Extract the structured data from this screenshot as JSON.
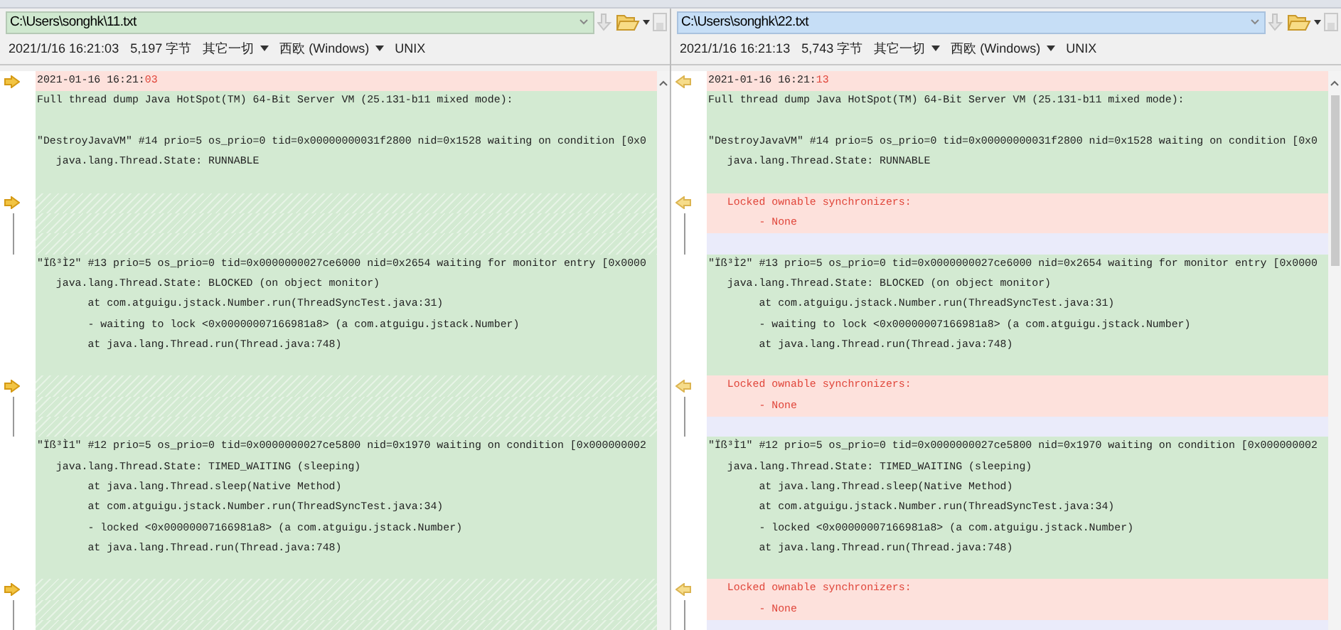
{
  "panes": [
    {
      "path": "C:\\Users\\songhk\\11.txt",
      "path_focused": false,
      "info": {
        "timestamp": "2021/1/16 16:21:03",
        "size": "5,197 字节",
        "charset": "其它一切",
        "encoding": "西欧 (Windows)",
        "line_ending": "UNIX"
      },
      "lines": [
        {
          "kind": "changed",
          "marker": true,
          "segments": [
            {
              "text": "2021-01-16 16:21:",
              "changed": false
            },
            {
              "text": "03",
              "changed": true
            }
          ]
        },
        {
          "kind": "same",
          "marker": false,
          "text": "Full thread dump Java HotSpot(TM) 64-Bit Server VM (25.131-b11 mixed mode):"
        },
        {
          "kind": "same",
          "marker": false
        },
        {
          "kind": "same",
          "marker": false,
          "text": "\"DestroyJavaVM\" #14 prio=5 os_prio=0 tid=0x00000000031f2800 nid=0x1528 waiting on condition [0x0"
        },
        {
          "kind": "same",
          "marker": false,
          "text": "   java.lang.Thread.State: RUNNABLE"
        },
        {
          "kind": "same",
          "marker": false
        },
        {
          "kind": "filler",
          "marker": true
        },
        {
          "kind": "filler",
          "marker": false
        },
        {
          "kind": "filler",
          "marker": false
        },
        {
          "kind": "same",
          "marker": false,
          "text": "\"Ïß³Ì2\" #13 prio=5 os_prio=0 tid=0x0000000027ce6000 nid=0x2654 waiting for monitor entry [0x0000"
        },
        {
          "kind": "same",
          "marker": false,
          "text": "   java.lang.Thread.State: BLOCKED (on object monitor)"
        },
        {
          "kind": "same",
          "marker": false,
          "text": "        at com.atguigu.jstack.Number.run(ThreadSyncTest.java:31)"
        },
        {
          "kind": "same",
          "marker": false,
          "text": "        - waiting to lock <0x00000007166981a8> (a com.atguigu.jstack.Number)"
        },
        {
          "kind": "same",
          "marker": false,
          "text": "        at java.lang.Thread.run(Thread.java:748)"
        },
        {
          "kind": "same",
          "marker": false
        },
        {
          "kind": "filler",
          "marker": true
        },
        {
          "kind": "filler",
          "marker": false
        },
        {
          "kind": "filler",
          "marker": false
        },
        {
          "kind": "same",
          "marker": false,
          "text": "\"Ïß³Ì1\" #12 prio=5 os_prio=0 tid=0x0000000027ce5800 nid=0x1970 waiting on condition [0x000000002"
        },
        {
          "kind": "same",
          "marker": false,
          "text": "   java.lang.Thread.State: TIMED_WAITING (sleeping)"
        },
        {
          "kind": "same",
          "marker": false,
          "text": "        at java.lang.Thread.sleep(Native Method)"
        },
        {
          "kind": "same",
          "marker": false,
          "text": "        at com.atguigu.jstack.Number.run(ThreadSyncTest.java:34)"
        },
        {
          "kind": "same",
          "marker": false,
          "text": "        - locked <0x00000007166981a8> (a com.atguigu.jstack.Number)"
        },
        {
          "kind": "same",
          "marker": false,
          "text": "        at java.lang.Thread.run(Thread.java:748)"
        },
        {
          "kind": "same",
          "marker": false
        },
        {
          "kind": "filler",
          "marker": true
        },
        {
          "kind": "filler",
          "marker": false
        },
        {
          "kind": "filler",
          "marker": false
        }
      ]
    },
    {
      "path": "C:\\Users\\songhk\\22.txt",
      "path_focused": true,
      "info": {
        "timestamp": "2021/1/16 16:21:13",
        "size": "5,743 字节",
        "charset": "其它一切",
        "encoding": "西欧 (Windows)",
        "line_ending": "UNIX"
      },
      "lines": [
        {
          "kind": "changed",
          "marker": true,
          "segments": [
            {
              "text": "2021-01-16 16:21:",
              "changed": false
            },
            {
              "text": "13",
              "changed": true
            }
          ]
        },
        {
          "kind": "same",
          "marker": false,
          "text": "Full thread dump Java HotSpot(TM) 64-Bit Server VM (25.131-b11 mixed mode):"
        },
        {
          "kind": "same",
          "marker": false
        },
        {
          "kind": "same",
          "marker": false,
          "text": "\"DestroyJavaVM\" #14 prio=5 os_prio=0 tid=0x00000000031f2800 nid=0x1528 waiting on condition [0x0"
        },
        {
          "kind": "same",
          "marker": false,
          "text": "   java.lang.Thread.State: RUNNABLE"
        },
        {
          "kind": "same",
          "marker": false
        },
        {
          "kind": "added",
          "marker": true,
          "text": "   Locked ownable synchronizers:"
        },
        {
          "kind": "added",
          "marker": false,
          "text": "        - None"
        },
        {
          "kind": "empty",
          "marker": false
        },
        {
          "kind": "same",
          "marker": false,
          "text": "\"Ïß³Ì2\" #13 prio=5 os_prio=0 tid=0x0000000027ce6000 nid=0x2654 waiting for monitor entry [0x0000"
        },
        {
          "kind": "same",
          "marker": false,
          "text": "   java.lang.Thread.State: BLOCKED (on object monitor)"
        },
        {
          "kind": "same",
          "marker": false,
          "text": "        at com.atguigu.jstack.Number.run(ThreadSyncTest.java:31)"
        },
        {
          "kind": "same",
          "marker": false,
          "text": "        - waiting to lock <0x00000007166981a8> (a com.atguigu.jstack.Number)"
        },
        {
          "kind": "same",
          "marker": false,
          "text": "        at java.lang.Thread.run(Thread.java:748)"
        },
        {
          "kind": "same",
          "marker": false
        },
        {
          "kind": "added",
          "marker": true,
          "text": "   Locked ownable synchronizers:"
        },
        {
          "kind": "added",
          "marker": false,
          "text": "        - None"
        },
        {
          "kind": "empty",
          "marker": false
        },
        {
          "kind": "same",
          "marker": false,
          "text": "\"Ïß³Ì1\" #12 prio=5 os_prio=0 tid=0x0000000027ce5800 nid=0x1970 waiting on condition [0x000000002"
        },
        {
          "kind": "same",
          "marker": false,
          "text": "   java.lang.Thread.State: TIMED_WAITING (sleeping)"
        },
        {
          "kind": "same",
          "marker": false,
          "text": "        at java.lang.Thread.sleep(Native Method)"
        },
        {
          "kind": "same",
          "marker": false,
          "text": "        at com.atguigu.jstack.Number.run(ThreadSyncTest.java:34)"
        },
        {
          "kind": "same",
          "marker": false,
          "text": "        - locked <0x00000007166981a8> (a com.atguigu.jstack.Number)"
        },
        {
          "kind": "same",
          "marker": false,
          "text": "        at java.lang.Thread.run(Thread.java:748)"
        },
        {
          "kind": "same",
          "marker": false
        },
        {
          "kind": "added",
          "marker": true,
          "text": "   Locked ownable synchronizers:"
        },
        {
          "kind": "added",
          "marker": false,
          "text": "        - None"
        },
        {
          "kind": "empty",
          "marker": false
        }
      ]
    }
  ]
}
